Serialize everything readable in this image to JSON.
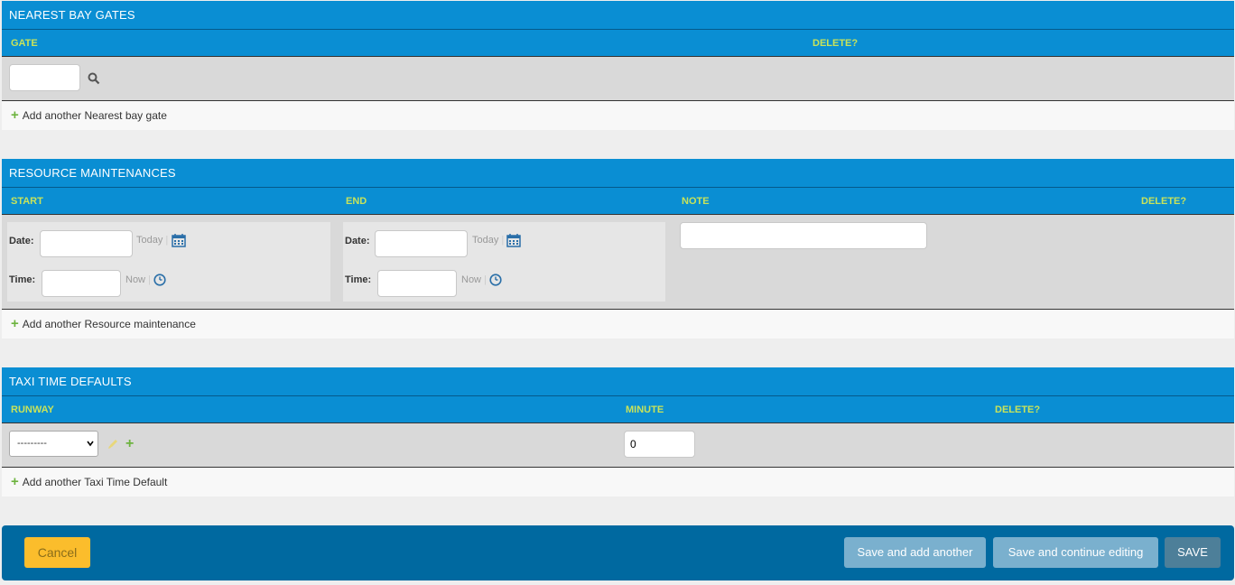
{
  "nearest_bay_gates": {
    "title": "NEAREST BAY GATES",
    "columns": [
      "GATE",
      "DELETE?"
    ],
    "gate_value": "",
    "add_label": "Add another Nearest bay gate"
  },
  "resource_maintenances": {
    "title": "RESOURCE MAINTENANCES",
    "columns": [
      "START",
      "END",
      "NOTE",
      "DELETE?"
    ],
    "start": {
      "date_label": "Date:",
      "time_label": "Time:",
      "date_value": "",
      "time_value": "",
      "today": "Today",
      "now": "Now"
    },
    "end": {
      "date_label": "Date:",
      "time_label": "Time:",
      "date_value": "",
      "time_value": "",
      "today": "Today",
      "now": "Now"
    },
    "note_value": "",
    "add_label": "Add another Resource maintenance"
  },
  "taxi_time_defaults": {
    "title": "TAXI TIME DEFAULTS",
    "columns": [
      "RUNWAY",
      "MINUTE",
      "DELETE?"
    ],
    "runway_selected": "---------",
    "minute_value": "0",
    "add_label": "Add another Taxi Time Default"
  },
  "footer": {
    "cancel": "Cancel",
    "save_add_another": "Save and add another",
    "save_continue": "Save and continue editing",
    "save": "SAVE"
  },
  "colors": {
    "header_blue": "#0a8ed3",
    "column_label": "#c8e35a",
    "footer_blue": "#0069a0",
    "cancel_yellow": "#fbbd2c",
    "plus_green": "#6db33f"
  }
}
